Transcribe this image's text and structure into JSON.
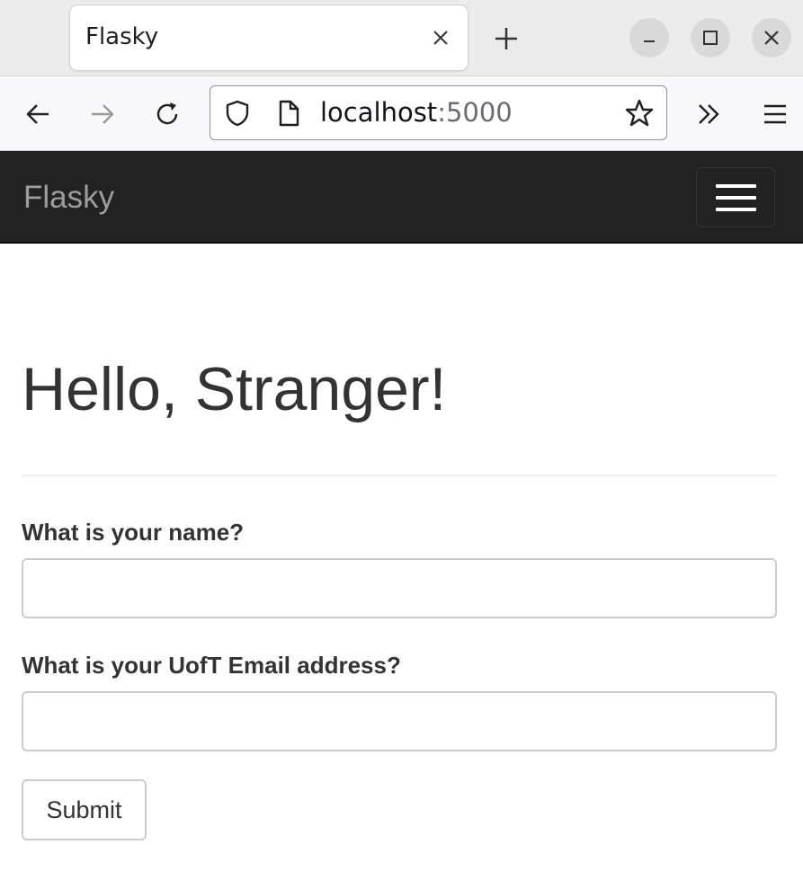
{
  "browser": {
    "tab": {
      "title": "Flasky"
    },
    "url": {
      "host": "localhost",
      "port": ":5000"
    },
    "icons": [
      "back-icon",
      "forward-icon",
      "reload-icon",
      "shield-icon",
      "page-icon",
      "star-icon",
      "overflow-icon",
      "menu-icon",
      "close-icon",
      "new-tab-icon",
      "minimize-icon",
      "maximize-icon"
    ]
  },
  "navbar": {
    "brand": "Flasky",
    "toggle_icon": "hamburger-icon",
    "background": "#222222"
  },
  "page": {
    "heading": "Hello, Stranger!",
    "form": {
      "name_label": "What is your name?",
      "name_value": "",
      "email_label": "What is your UofT Email address?",
      "email_value": "",
      "submit_label": "Submit"
    }
  }
}
